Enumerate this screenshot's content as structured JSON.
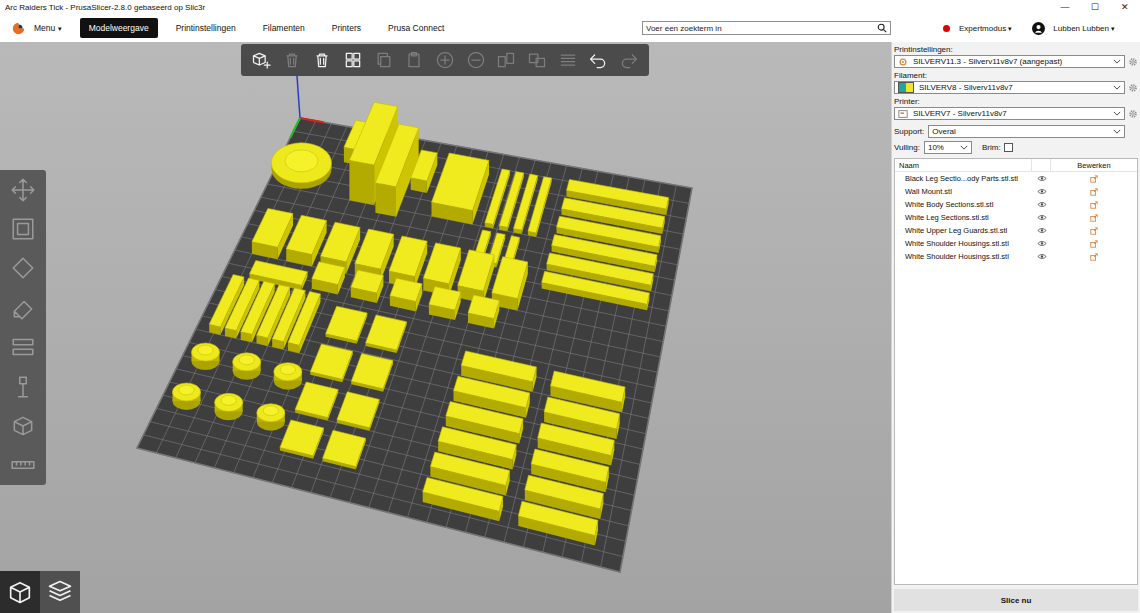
{
  "window": {
    "title": "Arc Raiders Tick - PrusaSlicer-2.8.0 gebaseerd op Slic3r",
    "controls": [
      "—",
      "☐",
      "✕"
    ]
  },
  "menu": {
    "label": "Menu",
    "arrow": "▾"
  },
  "tabs": [
    {
      "label": "Modelweergave",
      "selected": true
    },
    {
      "label": "Printinstellingen",
      "selected": false
    },
    {
      "label": "Filamenten",
      "selected": false
    },
    {
      "label": "Printers",
      "selected": false
    },
    {
      "label": "Prusa Connect",
      "selected": false
    }
  ],
  "search": {
    "placeholder": "Voer een zoekterm in"
  },
  "mode": {
    "label": "Expertmodus",
    "arrow": "▾"
  },
  "user": {
    "name": "Lubben Lubben",
    "arrow": "▾"
  },
  "toolbar": [
    {
      "kind": "add",
      "disabled": false
    },
    {
      "kind": "delete",
      "disabled": true
    },
    {
      "kind": "clear",
      "disabled": false
    },
    {
      "kind": "arrange",
      "disabled": false
    },
    {
      "kind": "copy",
      "disabled": true
    },
    {
      "kind": "paste",
      "disabled": true
    },
    {
      "kind": "more",
      "disabled": true
    },
    {
      "kind": "fewer",
      "disabled": true
    },
    {
      "kind": "splitobjects",
      "disabled": true
    },
    {
      "kind": "splitparts",
      "disabled": true
    },
    {
      "kind": "layers",
      "disabled": true
    },
    {
      "kind": "undo",
      "disabled": false
    },
    {
      "kind": "redo",
      "disabled": true
    }
  ],
  "gizmos": [
    {
      "kind": "move",
      "disabled": true
    },
    {
      "kind": "scale",
      "disabled": true
    },
    {
      "kind": "rotate",
      "disabled": true
    },
    {
      "kind": "place",
      "disabled": true
    },
    {
      "kind": "cut",
      "disabled": true
    },
    {
      "kind": "supports",
      "disabled": true
    },
    {
      "kind": "hollow",
      "disabled": true
    },
    {
      "kind": "measure",
      "disabled": true
    }
  ],
  "views": [
    {
      "kind": "view3d",
      "selected": true
    },
    {
      "kind": "preview",
      "selected": false
    }
  ],
  "settings": [
    {
      "kind": "print",
      "label": "Printinstellingen:",
      "value": "SILVERV11.3 - Silverv11v8v7 (aangepast)"
    },
    {
      "kind": "filament",
      "label": "Filament:",
      "value": "SILVERV8 - Silverv11v8v7"
    },
    {
      "kind": "printer",
      "label": "Printer:",
      "value": "SILVERV7 - Silverv11v8v7"
    }
  ],
  "support": {
    "label": "Support:",
    "value": "Overal"
  },
  "infill": {
    "label": "Vulling:",
    "value": "10%"
  },
  "brim": {
    "label": "Brim:",
    "checked": false
  },
  "objects": {
    "columns": [
      "Naam",
      "Bewerken"
    ],
    "rows": [
      {
        "name": "Black Leg Sectio...ody Parts.stl.stl",
        "visible": true
      },
      {
        "name": "Wall Mount.stl",
        "visible": true
      },
      {
        "name": "White Body Sections.stl.stl",
        "visible": true
      },
      {
        "name": "White Leg Sections.stl.stl",
        "visible": true
      },
      {
        "name": "White Upper Leg Guards.stl.stl",
        "visible": true
      },
      {
        "name": "White Shoulder Housings.stl.stl",
        "visible": true
      },
      {
        "name": "White Shoulder Housings.stl.stl",
        "visible": true
      }
    ]
  },
  "slice_button": {
    "label": "Slice nu"
  }
}
